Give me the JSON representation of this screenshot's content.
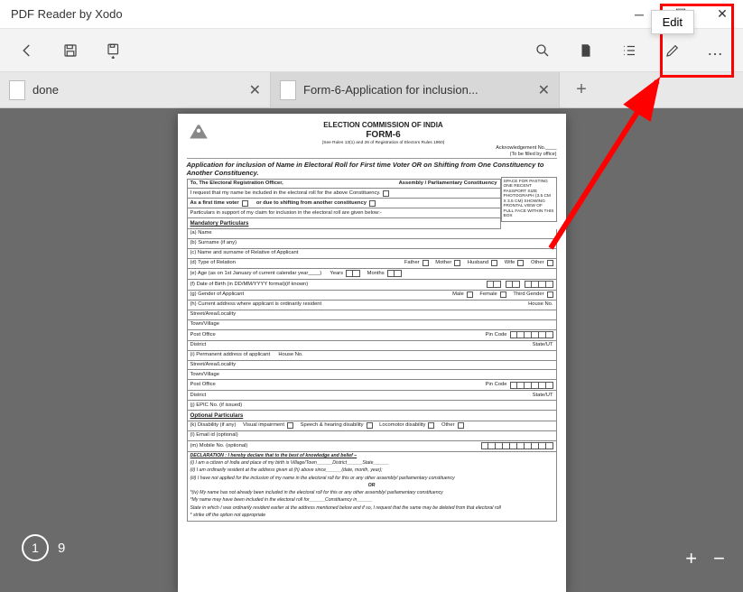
{
  "window": {
    "title": "PDF Reader by Xodo"
  },
  "tooltip": {
    "edit": "Edit"
  },
  "tabs": {
    "items": [
      {
        "label": "done"
      },
      {
        "label": "Form-6-Application for inclusion..."
      }
    ]
  },
  "pager": {
    "current": "1",
    "total": "9"
  },
  "form": {
    "org": "ELECTION COMMISSION OF INDIA",
    "formno": "FORM-6",
    "sub": "(See Rules 13(1) and 26 of Registration of Electors Rules 1960)",
    "ack": "Acknowledgement No.____",
    "fillby": "(To be filled by office)",
    "app_title": "Application for inclusion of Name in Electoral Roll for First time Voter OR on Shifting from One Constituency to Another Constituency.",
    "to": "To, The Electoral Registration Officer,",
    "assembly": "Assembly / Parliamentary Constituency",
    "request": "I request that my name be included in the electoral roll for the above Constituency.",
    "first_time": "As a first time voter",
    "shift": "or due to shifting from another constituency",
    "particulars": "Particulars in support of my claim for inclusion in the electoral roll are given below:-",
    "mand": "Mandatory Particulars",
    "name": "(a) Name",
    "surname": "(b) Surname (if any)",
    "relname": "(c) Name and surname of Relative of Applicant",
    "reltype": "(d) Type of Relation",
    "father": "Father",
    "mother": "Mother",
    "husband": "Husband",
    "wife": "Wife",
    "other": "Other",
    "age": "(e) Age (as on 1st January of current calendar year____)",
    "years": "Years",
    "months": "Months",
    "dob": "(f) Date of Birth (in DD/MM/YYYY format)(if known)",
    "gender": "(g) Gender of Applicant",
    "male": "Male",
    "female": "Female",
    "third": "Third Gender",
    "curaddr": "(h) Current address where applicant is ordinarily resident",
    "houseno": "House No.",
    "street": "Street/Area/Locality",
    "town": "Town/Village",
    "post": "Post Office",
    "pin": "Pin Code",
    "district": "District",
    "state": "State/UT",
    "permaddr": "(i) Permanent address of applicant",
    "epic": "(j) EPIC No. (if issued)",
    "opt": "Optional Particulars",
    "disability": "(k) Disability (if any)",
    "vis": "Visual impairment",
    "speech": "Speech & hearing disability",
    "loco": "Locomotor disability",
    "oth2": "Other",
    "email": "(l) Email id (optional)",
    "mobile": "(m) Mobile No. (optional)",
    "decl": "DECLARATION : I hereby declare that to the best of knowledge and belief –",
    "d1": "(i) I am a citizen of India and place of my birth is Village/Town______District______State______",
    "d2": "(ii) I am ordinarily resident at the address given at (h) above since______(date, month, year);",
    "d3": "(iii) I have not applied for the inclusion of my name in the electoral roll for this or any other assembly/ parliamentary constituency",
    "or": "OR",
    "d4": "*(iv) My name has not already been included in the electoral roll for this or any other assembly/ parliamentary constituency",
    "d5": "*My name may have been included in the electoral roll for______Constituency in______",
    "d6": "State in which I was ordinarily resident earlier at the address mentioned below and if so, I request that the same may be deleted from that electoral roll",
    "strike": "* strike off the option not appropriate",
    "photo": "SPACE FOR PASTING ONE RECENT PASSPORT SIZE PHOTOGRAPH (3.5 CM X 3.5 CM) SHOWING FRONTAL VIEW OF FULL FACE WITHIN THIS BOX"
  }
}
